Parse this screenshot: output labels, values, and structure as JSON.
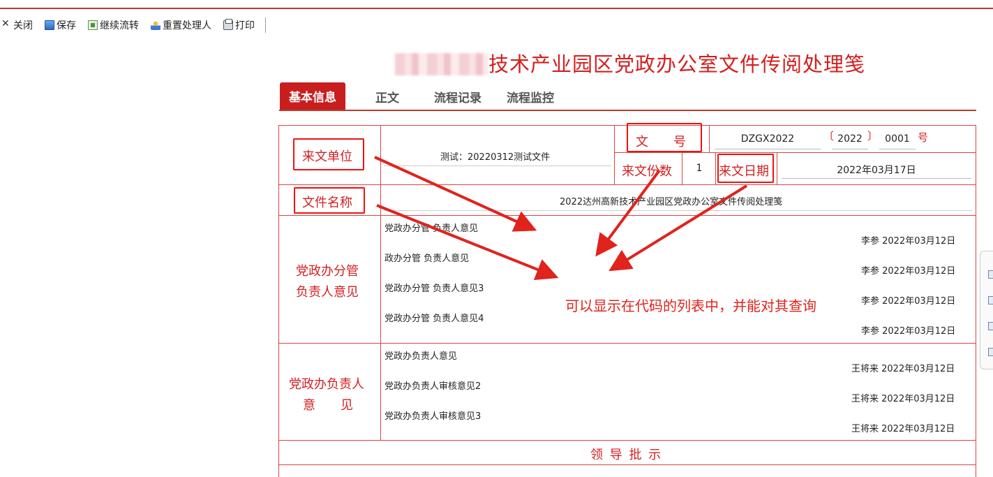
{
  "toolbar": {
    "close_label": "关闭",
    "save_label": "保存",
    "continue_label": "继续流转",
    "reset_label": "重置处理人",
    "print_label": "打印"
  },
  "page": {
    "title_visible": "技术产业园区党政办公室文件传阅处理笺"
  },
  "tabs": [
    "基本信息",
    "正文",
    "流程记录",
    "流程监控"
  ],
  "form": {
    "labels": {
      "source_unit": "来文单位",
      "doc_number": "文　　号",
      "copies": "来文份数",
      "date": "来文日期",
      "file_name": "文件名称",
      "dept_head_opinion_1": "党政办分管",
      "dept_head_opinion_2": "负责人意见",
      "office_head_1": "党政办负责人",
      "office_head_2": "意　　见",
      "leader_instructions": "领 导 批 示"
    },
    "source_unit_value": "测试：20220312测试文件",
    "doc_prefix": "DZGX2022",
    "doc_year": "2022",
    "doc_serial": "0001",
    "doc_bracket_open": "〔",
    "doc_bracket_close": "〕",
    "doc_suffix": "号",
    "copies_value": "1",
    "date_value": "2022年03月17日",
    "file_name_value": "2022达州高新技术产业园区党政办公室文件传阅处理笺",
    "dept_opinions": [
      {
        "text": "党政办分管 负责人意见",
        "sign": "李参 2022年03月12日"
      },
      {
        "text": "政办分管 负责人意见",
        "sign": "李参 2022年03月12日"
      },
      {
        "text": "党政办分管 负责人意见3",
        "sign": "李参 2022年03月12日"
      },
      {
        "text": "党政办分管 负责人意见4",
        "sign": "李参 2022年03月12日"
      }
    ],
    "office_opinions": [
      {
        "text": "党政办负责人意见",
        "sign": "王将来 2022年03月12日"
      },
      {
        "text": "党政办负责人审核意见2",
        "sign": "王将来 2022年03月12日"
      },
      {
        "text": "党政办负责人审核意见3",
        "sign": "王将来 2022年03月12日"
      }
    ]
  },
  "annotation": "可以显示在代码的列表中，并能对其查询",
  "colors": {
    "accent": "#c81e1e",
    "annotation": "#e0231d",
    "border": "#d94545"
  },
  "icons": [
    "close-icon",
    "save-icon",
    "flow-icon",
    "user-icon",
    "print-icon"
  ]
}
